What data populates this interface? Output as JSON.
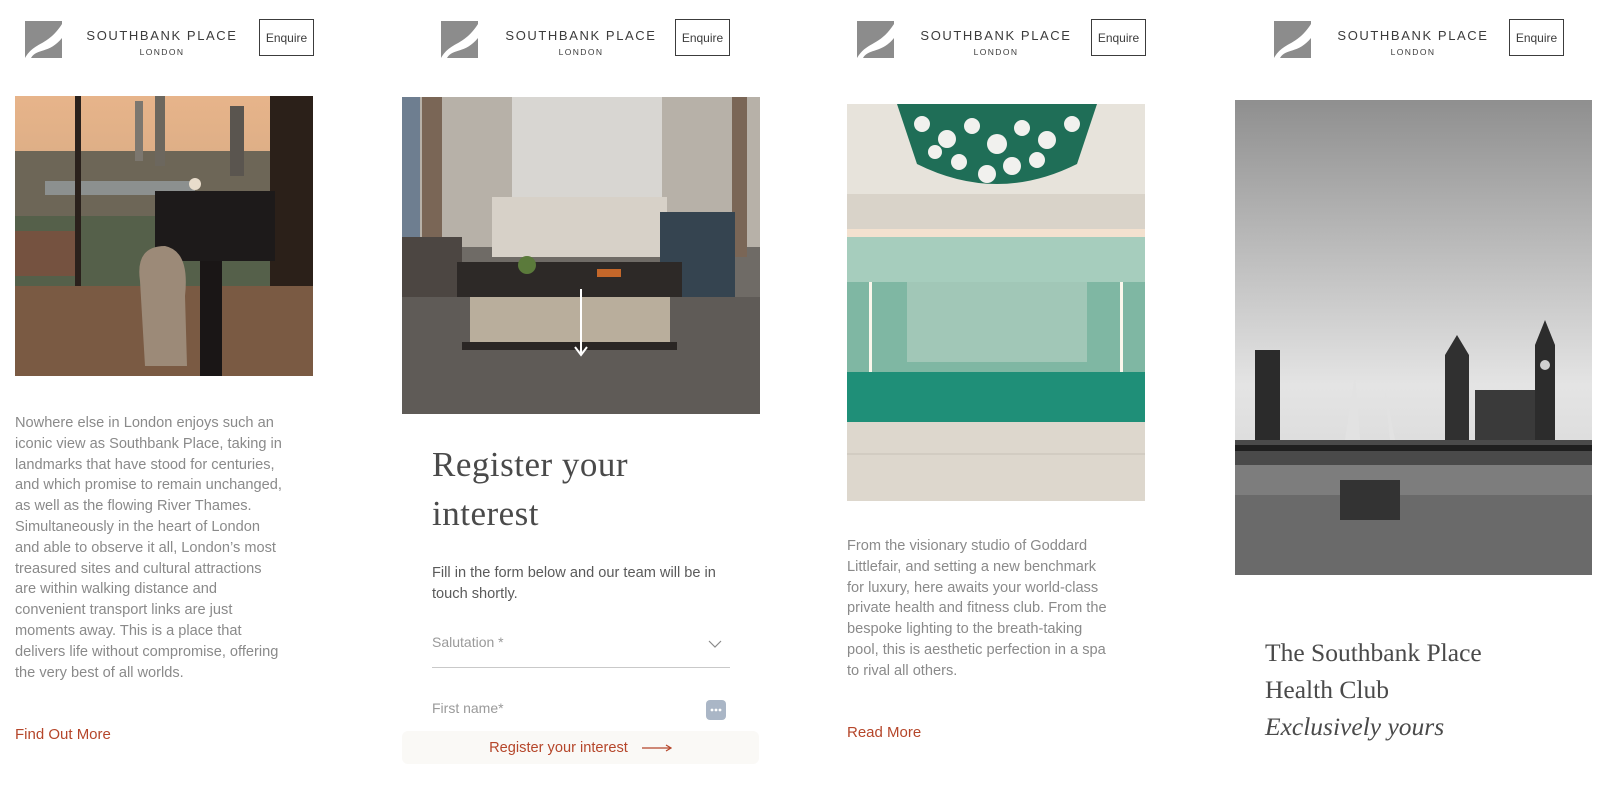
{
  "brand": {
    "name": "SOUTHBANK PLACE",
    "sub": "LONDON",
    "enquire_label": "Enquire"
  },
  "panel1": {
    "body": "Nowhere else in London enjoys such an iconic view as Southbank Place, taking in landmarks that have stood for centuries, and which promise to remain unchanged, as well as the flowing River Thames. Simultaneously in the heart of London and able to observe it all, London’s most treasured sites and cultural attractions are within walking distance and convenient transport links are just moments away. This is a place that delivers life without compromise, offering the very best of all worlds.",
    "link": "Find Out More"
  },
  "panel2": {
    "heading_line1": "Register your",
    "heading_line2": "interest",
    "intro": "Fill in the form below and our team will be in touch shortly.",
    "salutation_placeholder": "Salutation *",
    "firstname_placeholder": "First name*",
    "register_cta": "Register your interest"
  },
  "panel3": {
    "body": "From the visionary studio of Goddard Littlefair, and setting a new benchmark for luxury, here awaits your world-class private health and fitness club. From the bespoke lighting to the breath-taking pool, this is aesthetic perfection in a spa to rival all others.",
    "link": "Read More"
  },
  "panel4": {
    "heading_line1": "The Southbank Place",
    "heading_line2": "Health Club",
    "tagline": "Exclusively yours"
  },
  "colors": {
    "accent": "#b5462a",
    "text": "#4a4a4a",
    "muted": "#8a8a8a",
    "logo": "#8c8c8c"
  }
}
